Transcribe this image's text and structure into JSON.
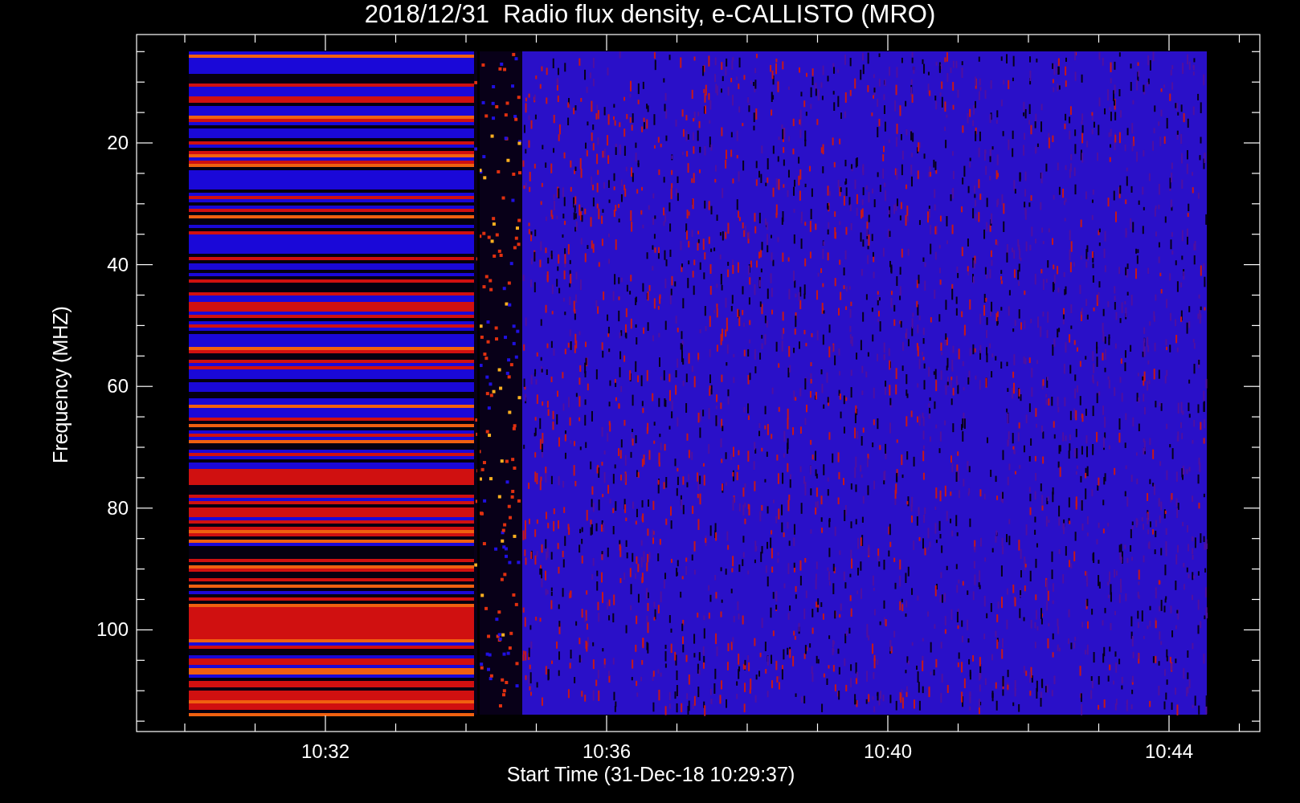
{
  "title": "2018/12/31  Radio flux density, e-CALLISTO (MRO)",
  "y_axis": {
    "label": "Frequency (MHZ)",
    "ticks": [
      "20",
      "40",
      "60",
      "80",
      "100"
    ]
  },
  "x_axis": {
    "label": "Start Time (31-Dec-18 10:29:37)",
    "ticks": [
      "10:32",
      "10:36",
      "10:40",
      "10:44"
    ]
  }
}
